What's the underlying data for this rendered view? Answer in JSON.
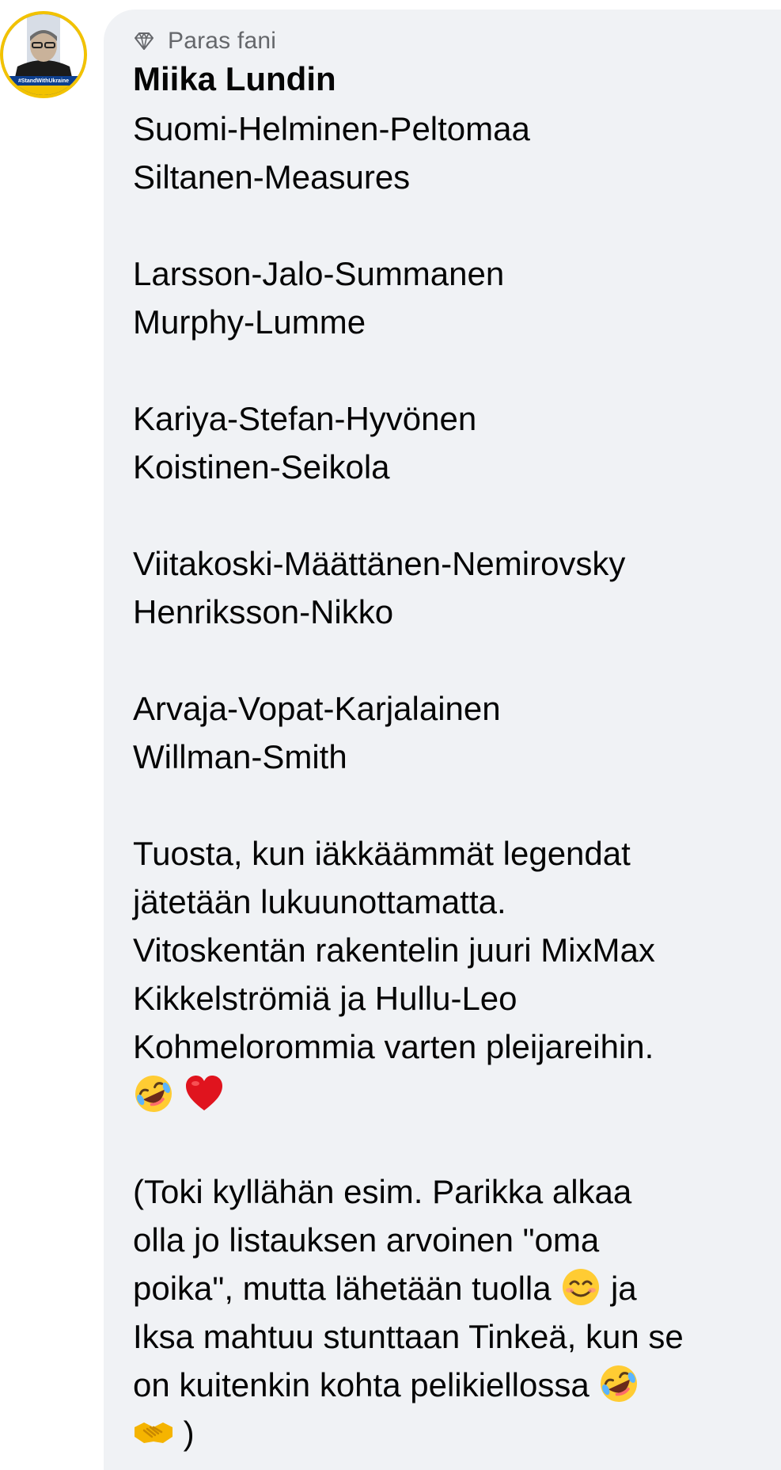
{
  "comment": {
    "badge_label": "Paras fani",
    "badge_icon": "gem-icon",
    "avatar_text": "#StandWithUkraine",
    "author": "Miika Lundin",
    "lines": [
      "Suomi-Helminen-Peltomaa",
      "Siltanen-Measures",
      "",
      "Larsson-Jalo-Summanen",
      "Murphy-Lumme",
      "",
      "Kariya-Stefan-Hyvönen",
      "Koistinen-Seikola",
      "",
      "Viitakoski-Määttänen-Nemirovsky",
      "Henriksson-Nikko",
      "",
      "Arvaja-Vopat-Karjalainen",
      "Willman-Smith",
      "",
      "Tuosta, kun iäkkäämmät legendat",
      "jätetään lukuunottamatta.",
      "Vitoskentän rakentelin juuri MixMax",
      "Kikkelströmiä ja Hullu-Leo",
      "Kohmelorommia varten pleijareihin.",
      "",
      "",
      "(Toki kyllähän esim. Parikka alkaa",
      "olla jo listauksen arvoinen \"oma",
      "poika\", mutta lähetään tuolla",
      "Iksa mahtuu stunttaan Tinkeä, kun se",
      "on kuitenkin kohta pelikiellossa",
      ")"
    ],
    "line_text_after_emoji": {
      "24": "ja"
    },
    "emojis": {
      "laughing_crying": "rolling-on-floor-laughing-icon",
      "heart": "red-heart-icon",
      "smile": "smiling-face-icon",
      "handshake": "handshake-icon"
    }
  },
  "colors": {
    "bubble": "#f0f2f5",
    "text": "#050505",
    "muted": "#65676b",
    "avatar_ring": "#f2c200",
    "avatar_blue": "#0d3f8f"
  }
}
